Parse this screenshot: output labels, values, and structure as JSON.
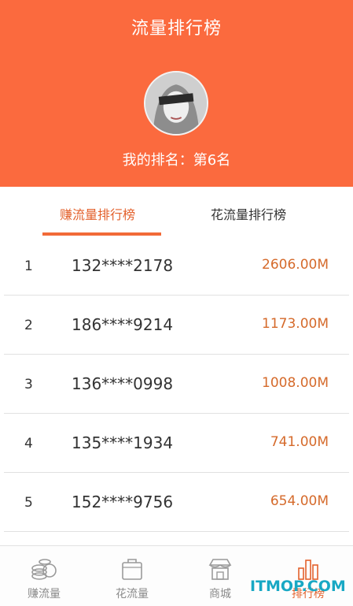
{
  "header": {
    "title": "流量排行榜",
    "my_rank": "我的排名：第6名"
  },
  "tabs": [
    {
      "label": "赚流量排行榜",
      "active": true
    },
    {
      "label": "花流量排行榜",
      "active": false
    }
  ],
  "rows": [
    {
      "rank": "1",
      "phone": "132****2178",
      "amount": "2606.00M"
    },
    {
      "rank": "2",
      "phone": "186****9214",
      "amount": "1173.00M"
    },
    {
      "rank": "3",
      "phone": "136****0998",
      "amount": "1008.00M"
    },
    {
      "rank": "4",
      "phone": "135****1934",
      "amount": "741.00M"
    },
    {
      "rank": "5",
      "phone": "152****9756",
      "amount": "654.00M"
    }
  ],
  "bottom_nav": [
    {
      "label": "赚流量",
      "icon": "coins-icon"
    },
    {
      "label": "花流量",
      "icon": "bag-icon"
    },
    {
      "label": "商城",
      "icon": "store-icon"
    },
    {
      "label": "排行榜",
      "icon": "bar-chart-icon",
      "active": true
    }
  ],
  "watermark": "ITMOP.COM",
  "colors": {
    "header": "#fb6a3e",
    "accent": "#e3612c",
    "amount": "#d56a2b"
  }
}
